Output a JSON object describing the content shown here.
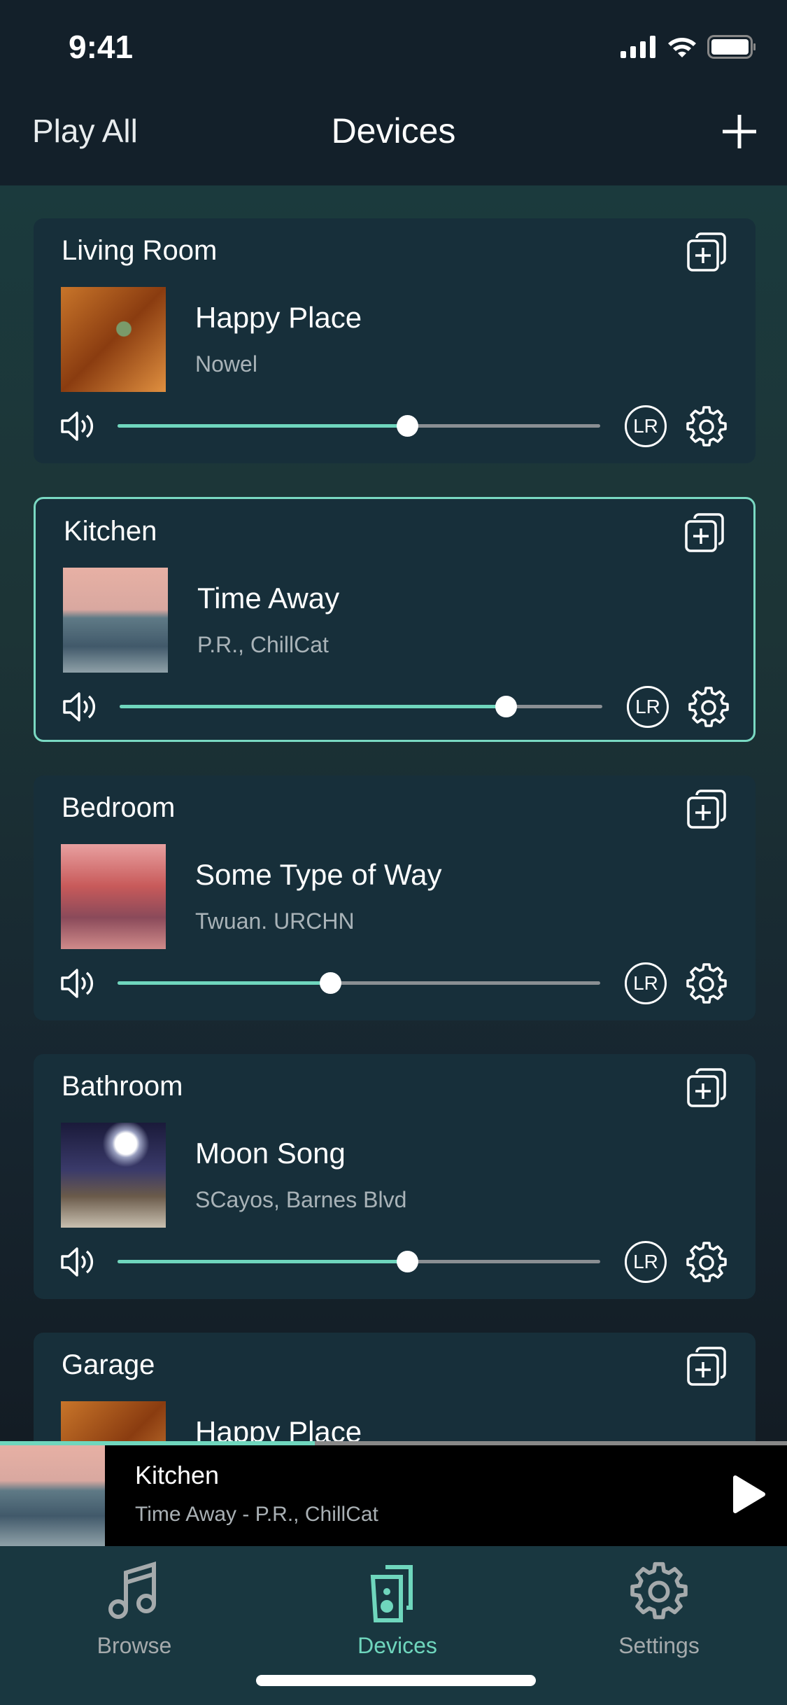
{
  "status_bar": {
    "time": "9:41"
  },
  "nav": {
    "left": "Play All",
    "title": "Devices"
  },
  "colors": {
    "accent": "#6fd6bd",
    "card": "#172f3a",
    "header": "#13202a"
  },
  "devices": [
    {
      "room": "Living Room",
      "song": "Happy Place",
      "artist": "Nowel",
      "volume": 0.6,
      "selected": false
    },
    {
      "room": "Kitchen",
      "song": "Time Away",
      "artist": "P.R., ChillCat",
      "volume": 0.8,
      "selected": true
    },
    {
      "room": "Bedroom",
      "song": "Some Type of Way",
      "artist": "Twuan. URCHN",
      "volume": 0.44,
      "selected": false
    },
    {
      "room": "Bathroom",
      "song": "Moon Song",
      "artist": "SCayos, Barnes Blvd",
      "volume": 0.6,
      "selected": false
    },
    {
      "room": "Garage",
      "song": "Happy Place",
      "artist": "",
      "volume": null,
      "selected": false
    }
  ],
  "lr_label": "LR",
  "mini_player": {
    "room": "Kitchen",
    "subtitle": "Time Away - P.R., ChillCat",
    "progress": 0.4
  },
  "tabs": [
    {
      "label": "Browse",
      "icon": "music-note-icon"
    },
    {
      "label": "Devices",
      "icon": "speakers-icon",
      "active": true
    },
    {
      "label": "Settings",
      "icon": "gear-icon"
    }
  ]
}
